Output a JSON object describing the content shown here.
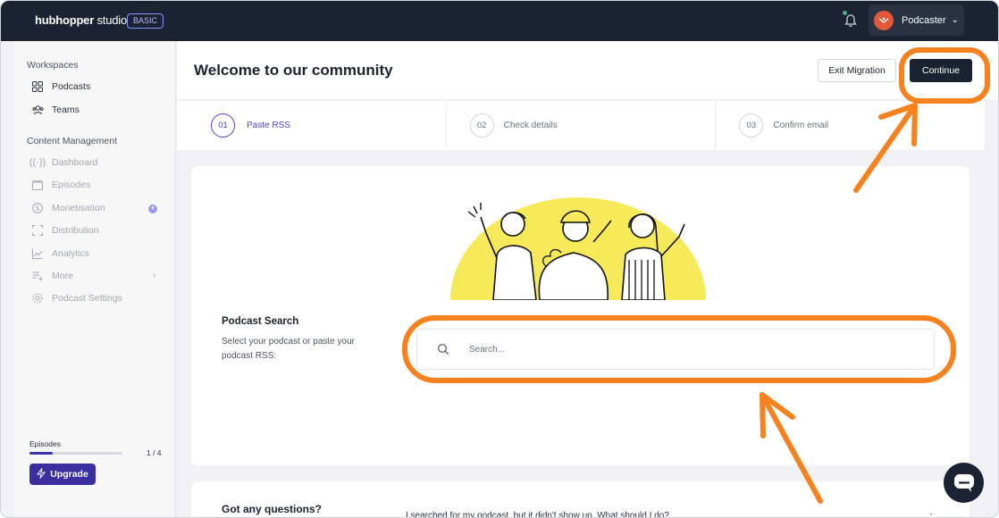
{
  "topbar": {
    "logo_brand": "hubhopper",
    "logo_suffix": " studio",
    "plan_badge": "BASIC",
    "user": {
      "name": "Podcaster"
    }
  },
  "sidebar": {
    "workspaces_heading": "Workspaces",
    "workspaces": [
      {
        "label": "Podcasts",
        "icon": "grid-icon"
      },
      {
        "label": "Teams",
        "icon": "users-icon"
      }
    ],
    "content_heading": "Content Management",
    "content_items": [
      {
        "label": "Dashboard",
        "icon": "broadcast-icon"
      },
      {
        "label": "Episodes",
        "icon": "folder-icon"
      },
      {
        "label": "Monetisation",
        "icon": "dollar-icon"
      },
      {
        "label": "Distribution",
        "icon": "expand-icon"
      },
      {
        "label": "Analytics",
        "icon": "chart-icon"
      },
      {
        "label": "More",
        "icon": "list-add-icon"
      },
      {
        "label": "Podcast Settings",
        "icon": "settings-icon"
      }
    ],
    "episodes_label": "Episodes",
    "episodes_count": "1 / 4",
    "episodes_progress": 0.25,
    "upgrade_label": "Upgrade"
  },
  "header": {
    "title": "Welcome to our community",
    "exit_label": "Exit Migration",
    "continue_label": "Continue"
  },
  "steps": [
    {
      "num": "01",
      "label": "Paste RSS",
      "active": true
    },
    {
      "num": "02",
      "label": "Check details",
      "active": false
    },
    {
      "num": "03",
      "label": "Confirm email",
      "active": false
    }
  ],
  "search": {
    "title": "Podcast Search",
    "description": "Select your podcast or paste your podcast RSS:",
    "placeholder": "Search...",
    "value": ""
  },
  "faq": {
    "title": "Got any questions?",
    "question": "I searched for my podcast, but it didn't show up. What should I do?"
  },
  "colors": {
    "topbar": "#1b2231",
    "accent": "#4c45c9",
    "upgrade": "#3a2fa0",
    "annotation": "#f5821f",
    "illustration_sun": "#f6ea5a"
  }
}
